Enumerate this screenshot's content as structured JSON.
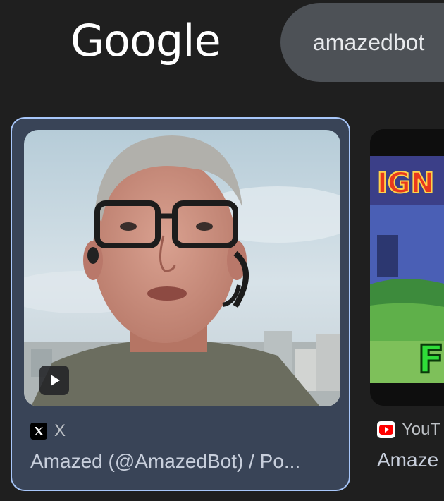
{
  "header": {
    "logo_text": "Google",
    "search_query": "amazedbot"
  },
  "results": [
    {
      "source": "X",
      "source_icon": "x-logo-icon",
      "title": "Amazed (@AmazedBot) / Po...",
      "thumbnail": "video-thumbnail-man-with-glasses-headset",
      "has_play_icon": true,
      "selected": true
    },
    {
      "source": "YouT",
      "source_icon": "youtube-logo-icon",
      "title": "Amaze",
      "thumbnail_text_top": "IGN",
      "thumbnail_text_bottom": "F"
    }
  ],
  "colors": {
    "background": "#1f1f1f",
    "search_box": "#4d5156",
    "selected_card": "#394457",
    "selected_border": "#a8c7fa"
  }
}
